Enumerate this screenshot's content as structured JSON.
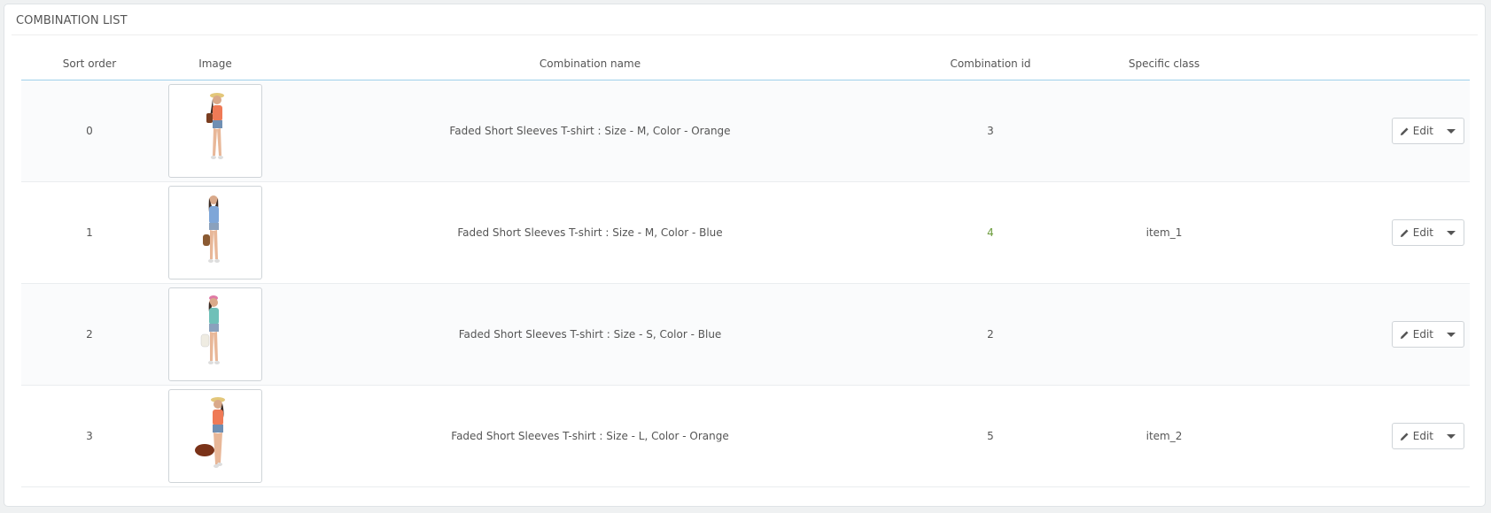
{
  "panel": {
    "title": "COMBINATION LIST"
  },
  "table": {
    "headers": {
      "sort_order": "Sort order",
      "image": "Image",
      "combination_name": "Combination name",
      "combination_id": "Combination id",
      "specific_class": "Specific class"
    },
    "rows": [
      {
        "sort_order": "0",
        "image_icon": "product-photo-orange-top",
        "name": "Faded Short Sleeves T-shirt : Size - M, Color - Orange",
        "id": "3",
        "specific_class": "",
        "edit_label": "Edit"
      },
      {
        "sort_order": "1",
        "image_icon": "product-photo-blue-top",
        "name": "Faded Short Sleeves T-shirt : Size - M, Color - Blue",
        "id": "4",
        "specific_class": "item_1",
        "edit_label": "Edit"
      },
      {
        "sort_order": "2",
        "image_icon": "product-photo-teal-top",
        "name": "Faded Short Sleeves T-shirt : Size - S, Color - Blue",
        "id": "2",
        "specific_class": "",
        "edit_label": "Edit"
      },
      {
        "sort_order": "3",
        "image_icon": "product-photo-orange-top-bag",
        "name": "Faded Short Sleeves T-shirt : Size - L, Color - Orange",
        "id": "5",
        "specific_class": "item_2",
        "edit_label": "Edit"
      }
    ]
  },
  "colors": {
    "header_border": "#a0d0eb",
    "id_highlight": "#6a9b3a"
  },
  "icons": {
    "edit": "pencil-icon",
    "dropdown": "caret-down-icon"
  }
}
